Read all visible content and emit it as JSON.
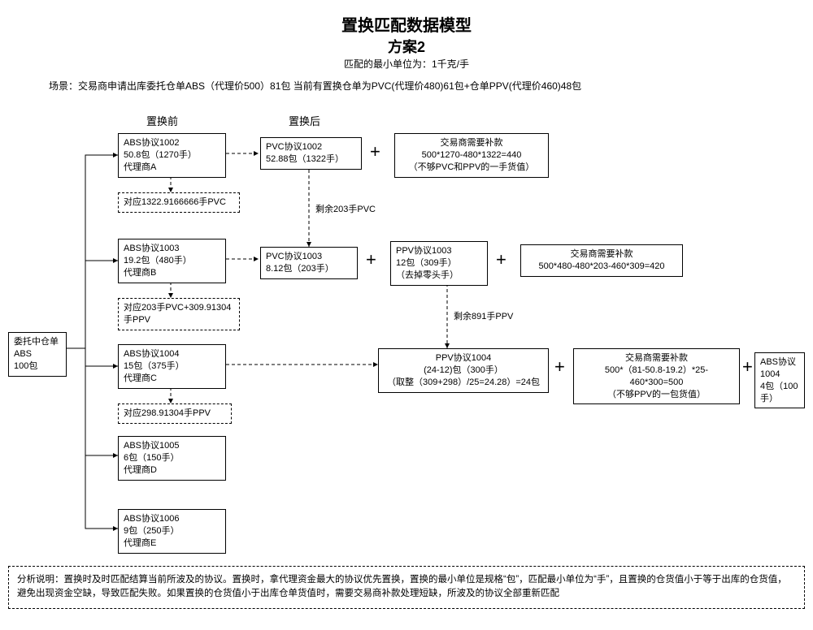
{
  "title": "置换匹配数据模型",
  "subtitle": "方案2",
  "unit_line": "匹配的最小单位为：1千克/手",
  "scenario": "场景：交易商申请出库委托仓单ABS（代理价500）81包    当前有置换仓单为PVC(代理价480)61包+仓单PPV(代理价460)48包",
  "col_headers": {
    "before": "置换前",
    "after": "置换后"
  },
  "source": {
    "l1": "委托中仓单ABS",
    "l2": "100包"
  },
  "row1": {
    "before": {
      "l1": "ABS协议1002",
      "l2": "50.8包（1270手）",
      "l3": "代理商A"
    },
    "beforeNote": "对应1322.9166666手PVC",
    "after": {
      "l1": "PVC协议1002",
      "l2": "52.88包（1322手）"
    },
    "flowNote": "剩余203手PVC",
    "pay": {
      "l1": "交易商需要补款",
      "l2": "500*1270-480*1322=440",
      "l3": "（不够PVC和PPV的一手货值）"
    }
  },
  "row2": {
    "before": {
      "l1": "ABS协议1003",
      "l2": "19.2包（480手）",
      "l3": "代理商B"
    },
    "beforeNote": "对应203手PVC+309.91304手PPV",
    "afterA": {
      "l1": "PVC协议1003",
      "l2": "8.12包（203手）"
    },
    "afterB": {
      "l1": "PPV协议1003",
      "l2": "12包（309手）",
      "l3": "（去掉零头手）"
    },
    "flowNote": "剩余891手PPV",
    "pay": {
      "l1": "交易商需要补款",
      "l2": "500*480-480*203-460*309=420"
    }
  },
  "row3": {
    "before": {
      "l1": "ABS协议1004",
      "l2": "15包（375手）",
      "l3": "代理商C"
    },
    "beforeNote": "对应298.91304手PPV",
    "afterB": {
      "l1": "PPV协议1004",
      "l2": "(24-12)包（300手）",
      "l3": "（取整（309+298）/25=24.28）=24包"
    },
    "pay": {
      "l1": "交易商需要补款",
      "l2": "500*（81-50.8-19.2）*25-460*300=500",
      "l3": "（不够PPV的一包货值）"
    },
    "extra": {
      "l1": "ABS协议1004",
      "l2": "4包（100手）"
    }
  },
  "row4": {
    "before": {
      "l1": "ABS协议1005",
      "l2": "6包（150手）",
      "l3": "代理商D"
    }
  },
  "row5": {
    "before": {
      "l1": "ABS协议1006",
      "l2": "9包（250手）",
      "l3": "代理商E"
    }
  },
  "analysis": "分析说明：置换时及时匹配结算当前所波及的协议。置换时，拿代理资金最大的协议优先置换，置换的最小单位是规格“包”，匹配最小单位为“手”，且置换的仓货值小于等于出库的仓货值，避免出现资金空缺，导致匹配失败。如果置换的仓货值小于出库仓单货值时，需要交易商补款处理短缺，所波及的协议全部重新匹配"
}
